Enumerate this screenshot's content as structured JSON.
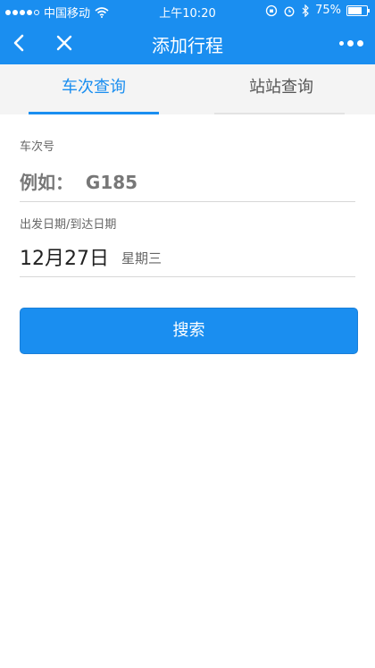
{
  "status_bar": {
    "carrier": "中国移动",
    "time": "上午10:20",
    "battery": "75%",
    "battery_level": 0.75,
    "signal_bars": 4
  },
  "nav": {
    "title": "添加行程",
    "back_icon": "chevron-left-icon",
    "close_icon": "close-icon",
    "more_icon": "more-dots-icon"
  },
  "tabs": [
    {
      "label": "车次查询",
      "active": true
    },
    {
      "label": "站站查询",
      "active": false
    }
  ],
  "form": {
    "train_no_label": "车次号",
    "train_no_placeholder": "例如：  G185",
    "date_label": "出发日期/到达日期",
    "date_value": "12月27日",
    "weekday": "星期三"
  },
  "search_button": "搜索",
  "colors": {
    "accent": "#1a8ef0",
    "tab_bg": "#f4f4f4"
  }
}
